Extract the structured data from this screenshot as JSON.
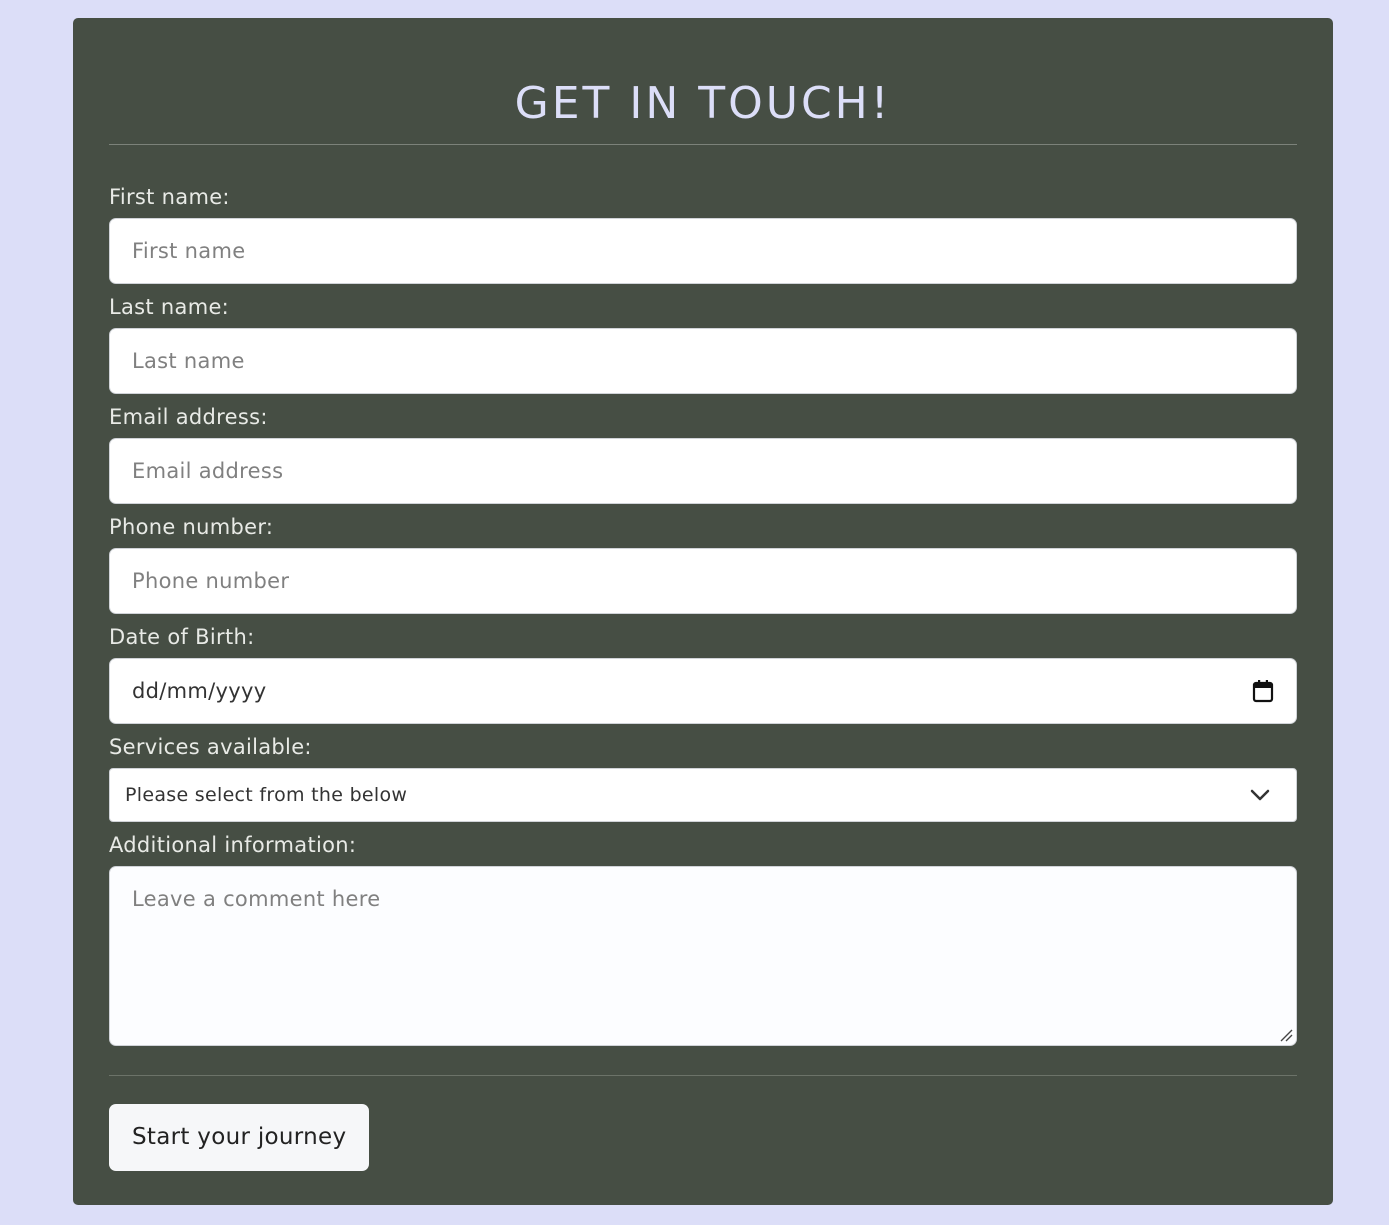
{
  "form": {
    "title": "GET IN TOUCH!",
    "fields": {
      "first_name": {
        "label": "First name:",
        "placeholder": "First name"
      },
      "last_name": {
        "label": "Last name:",
        "placeholder": "Last name"
      },
      "email": {
        "label": "Email address:",
        "placeholder": "Email address"
      },
      "phone": {
        "label": "Phone number:",
        "placeholder": "Phone number"
      },
      "dob": {
        "label": "Date of Birth:",
        "placeholder": "dd/mm/yyyy",
        "icon": "calendar-icon"
      },
      "services": {
        "label": "Services available:",
        "selected": "Please select from the below",
        "icon": "chevron-down-icon"
      },
      "additional": {
        "label": "Additional information:",
        "placeholder": "Leave a comment here"
      }
    },
    "submit_label": "Start your journey"
  },
  "colors": {
    "page_background": "#dcdef8",
    "card_background": "#464e44",
    "title_color": "#dcdef8",
    "input_background": "#ffffff",
    "button_background": "#f6f7f9"
  }
}
